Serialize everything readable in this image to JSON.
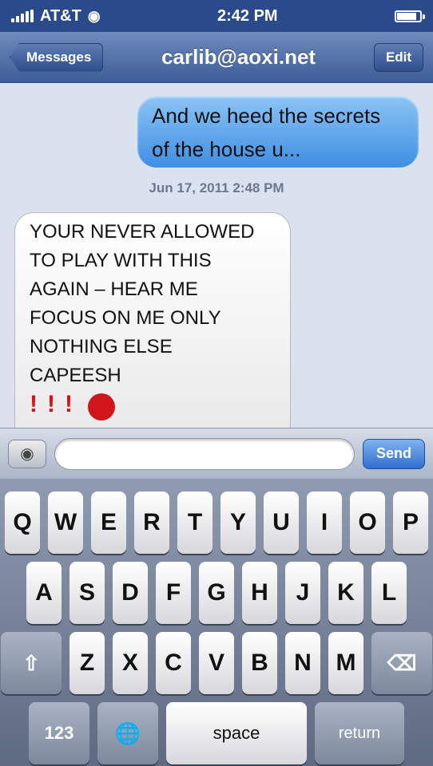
{
  "status_bar": {
    "carrier": "AT&T",
    "time": "2:42 PM",
    "battery_level": 0.85
  },
  "nav": {
    "back_label": "Messages",
    "title": "carlib@aoxi.net",
    "edit_label": "Edit"
  },
  "messages": [
    {
      "direction": "outgoing",
      "lines": [
        "And we heed the secrets",
        "of the house u..."
      ]
    },
    {
      "direction": "timestamp",
      "text": "Jun 17, 2011 2:48 PM"
    },
    {
      "direction": "incoming",
      "lines": [
        "YOUR NEVER ALLOWED",
        "TO PLAY WITH THIS",
        "AGAIN – HEAR ME",
        "FOCUS ON ME ONLY",
        "NOTHING ELSE",
        "CAPEESH",
        "!!!"
      ]
    }
  ],
  "input_bar": {
    "placeholder": "",
    "send_label": "Send"
  },
  "keyboard": {
    "row1": [
      "Q",
      "W",
      "E",
      "R",
      "T",
      "Y",
      "U",
      "I",
      "O",
      "P"
    ],
    "row2": [
      "A",
      "S",
      "D",
      "F",
      "G",
      "H",
      "J",
      "K",
      "L"
    ],
    "row3": [
      "Z",
      "X",
      "C",
      "V",
      "B",
      "N",
      "M"
    ],
    "numbers_label": "123",
    "space_label": "space",
    "return_label": "return"
  },
  "colors": {
    "nav_blue": "#3d5d98",
    "bubble_blue": "#3f8ee3",
    "alert_red": "#d0161b"
  },
  "icons": [
    "signal-icon",
    "wifi-icon",
    "battery-icon",
    "camera-icon",
    "emoji-icon",
    "shift-icon",
    "delete-icon",
    "globe-icon"
  ]
}
